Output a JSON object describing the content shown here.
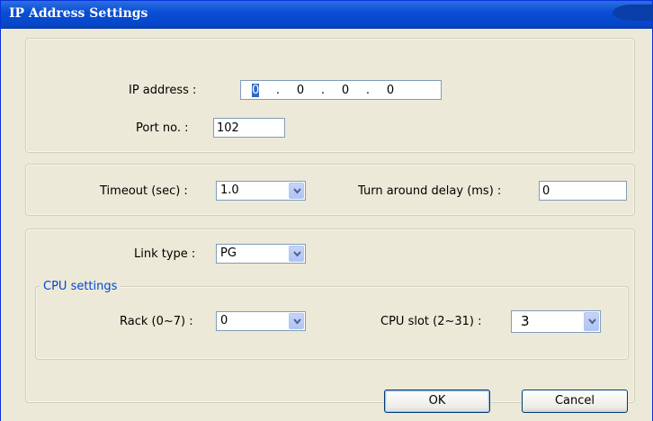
{
  "window": {
    "title": "IP Address Settings"
  },
  "address_group": {
    "ip_label": "IP address :",
    "ip_octets": [
      "0",
      "0",
      "0",
      "0"
    ],
    "ip_separator": ".",
    "port_label": "Port no. :",
    "port_value": "102"
  },
  "timing_group": {
    "timeout_label": "Timeout (sec) :",
    "timeout_value": "1.0",
    "turnaround_label": "Turn around delay (ms) :",
    "turnaround_value": "0"
  },
  "link_group": {
    "link_type_label": "Link type :",
    "link_type_value": "PG",
    "cpu_settings_legend": "CPU settings",
    "rack_label": "Rack (0~7) :",
    "rack_value": "0",
    "cpu_slot_label": "CPU slot (2~31) :",
    "cpu_slot_value": "3"
  },
  "buttons": {
    "ok": "OK",
    "cancel": "Cancel"
  },
  "icons": {
    "dropdown": "chevron-down-icon"
  }
}
